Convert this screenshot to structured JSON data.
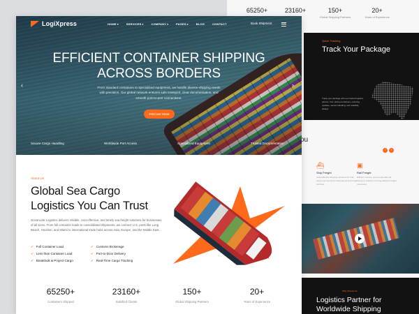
{
  "brand": {
    "name": "LogiXpress",
    "accent": "#ff6a1a"
  },
  "nav": {
    "items": [
      {
        "label": "HOME",
        "dropdown": true
      },
      {
        "label": "SERVICES",
        "dropdown": true
      },
      {
        "label": "COMPANY",
        "dropdown": true
      },
      {
        "label": "PAGES",
        "dropdown": true
      },
      {
        "label": "BLOG",
        "dropdown": false
      },
      {
        "label": "CONTACT",
        "dropdown": false
      }
    ],
    "cta": "Book Shipment",
    "menu_icon": "hamburger-icon"
  },
  "hero": {
    "title_line1": "EFFICIENT CONTAINER SHIPPING",
    "title_line2": "ACROSS BORDERS",
    "subtitle": "From standard containers to specialized equipment, we handle diverse shipping needs with precision. Our global network ensures safe transport, clear documentation, and smooth port-to-port connections.",
    "button": "Discover More",
    "features": [
      "Secure Cargo Handling",
      "Worldwide Port Access",
      "Specialized Equipment",
      "Trusted Documentation"
    ]
  },
  "about": {
    "tag": "About Us",
    "title": "Global Sea Cargo Logistics You Can Trust",
    "paragraph": "OceanLink Logistics delivers reliable, cost-effective, and timely sea freight solutions for businesses of all sizes. From full container loads to consolidated shipments, we connect U.S. ports like Long Beach, Houston, and Miami to international trade hubs across Asia, Europe, and the Middle East.",
    "checks": [
      "Full Container Load",
      "Customs Brokerage",
      "Less than Container Load",
      "Port-to-Door Delivery",
      "Breakbulk & Project Cargo",
      "Real-Time Cargo Tracking"
    ]
  },
  "stats": [
    {
      "value": "65250+",
      "label": "Containers Shipped"
    },
    {
      "value": "23160+",
      "label": "Satisfied Clients"
    },
    {
      "value": "150+",
      "label": "Global Shipping Partners"
    },
    {
      "value": "20+",
      "label": "Years of Experience"
    }
  ],
  "back_page": {
    "stats": [
      {
        "value": "65250+",
        "label": "Containers Shipped"
      },
      {
        "value": "23160+",
        "label": "Satisfied Clients"
      },
      {
        "value": "150+",
        "label": "Global Shipping Partners"
      },
      {
        "value": "20+",
        "label": "Years of Experience"
      }
    ],
    "track_tag": "Quick Tracking",
    "track_title": "Track Your Package",
    "track_text": "Track your package with our trusted logistics partner, from pickup to delivery, ensuring updates, secure handling, and reliability always.",
    "section_fragment": "ou",
    "services": [
      {
        "title": "Ship Freight",
        "text": "Cost-effective shipping solutions for bulk cargo and seamless international sea freight services."
      },
      {
        "title": "Rail Freight",
        "text": "Efficient, secure, and eco-friendly rail transport solutions for long-distance freight movement."
      }
    ],
    "why_tag": "Why Choose Us",
    "why_title": "Logistics Partner for Worldwide Shipping"
  }
}
